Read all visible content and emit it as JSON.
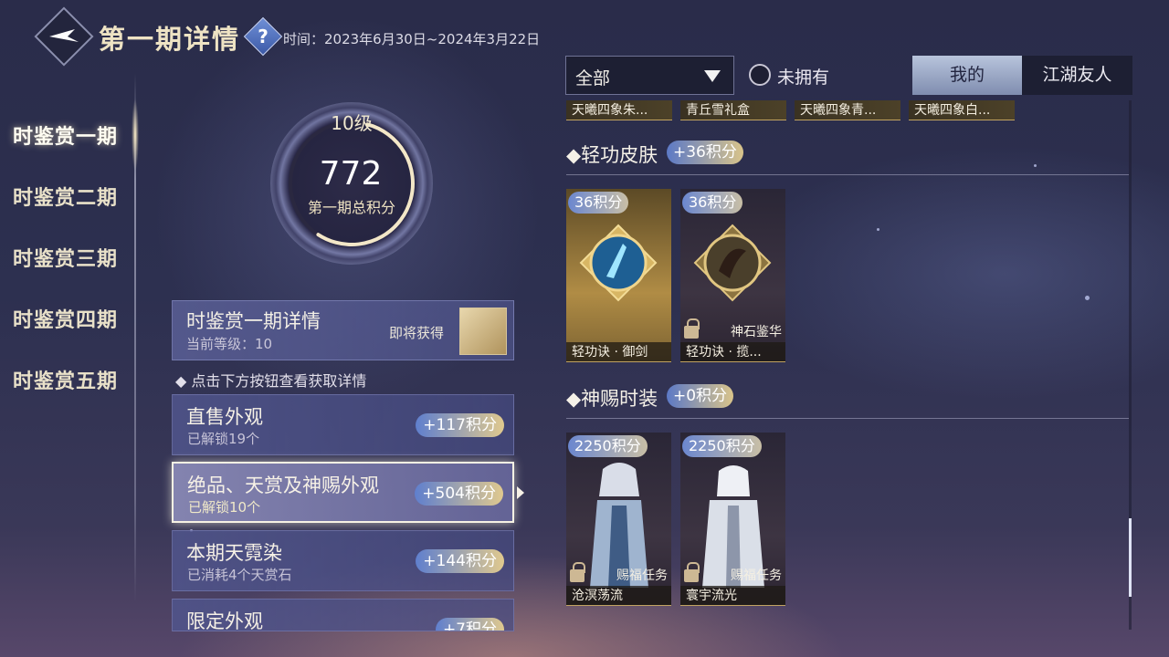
{
  "header": {
    "title": "第一期详情",
    "help_icon": "question-icon",
    "time_label": "时间：2023年6月30日~2024年3月22日"
  },
  "nav": {
    "items": [
      {
        "label": "时鉴赏一期",
        "active": true
      },
      {
        "label": "时鉴赏二期"
      },
      {
        "label": "时鉴赏三期"
      },
      {
        "label": "时鉴赏四期"
      },
      {
        "label": "时鉴赏五期"
      }
    ]
  },
  "summary": {
    "level": "10级",
    "score": "772",
    "score_label": "第一期总积分",
    "progress_fraction": 0.55
  },
  "detail_card": {
    "title": "时鉴赏一期详情",
    "current_level": "当前等级：10",
    "soon_label": "即将获得"
  },
  "hint": "◆ 点击下方按钮查看获取详情",
  "categories": [
    {
      "title": "直售外观",
      "sub": "已解锁19个",
      "points": "+117积分"
    },
    {
      "title": "绝品、天赏及神赐外观",
      "sub": "已解锁10个",
      "points": "+504积分",
      "selected": true
    },
    {
      "title": "本期天霓染",
      "sub": "已消耗4个天赏石",
      "points": "+144积分"
    },
    {
      "title": "限定外观",
      "sub": "",
      "points": "+7积分"
    }
  ],
  "filter": {
    "dropdown_value": "全部",
    "not_owned_label": "未拥有",
    "tabs": [
      {
        "label": "我的",
        "active": true
      },
      {
        "label": "江湖友人"
      }
    ]
  },
  "top_tags": [
    "天曦四象朱...",
    "青丘雪礼盒",
    "天曦四象青...",
    "天曦四象白..."
  ],
  "sections": [
    {
      "title": "轻功皮肤",
      "points": "+36积分",
      "items": [
        {
          "badge": "36积分",
          "name": "轻功诀 · 御剑",
          "source": "",
          "locked": false,
          "style": "gold"
        },
        {
          "badge": "36积分",
          "name": "轻功诀 · 揽...",
          "source": "神石鉴华",
          "locked": true,
          "style": "dark"
        }
      ]
    },
    {
      "title": "神赐时装",
      "points": "+0积分",
      "items": [
        {
          "badge": "2250积分",
          "name": "沧溟荡流",
          "source": "赐福任务",
          "locked": true,
          "style": "dark"
        },
        {
          "badge": "2250积分",
          "name": "寰宇流光",
          "source": "赐福任务",
          "locked": true,
          "style": "dark"
        }
      ]
    }
  ],
  "colors": {
    "accent_gold": "#e0c98e",
    "accent_blue": "#5f7fce",
    "panel": "#50558c"
  }
}
